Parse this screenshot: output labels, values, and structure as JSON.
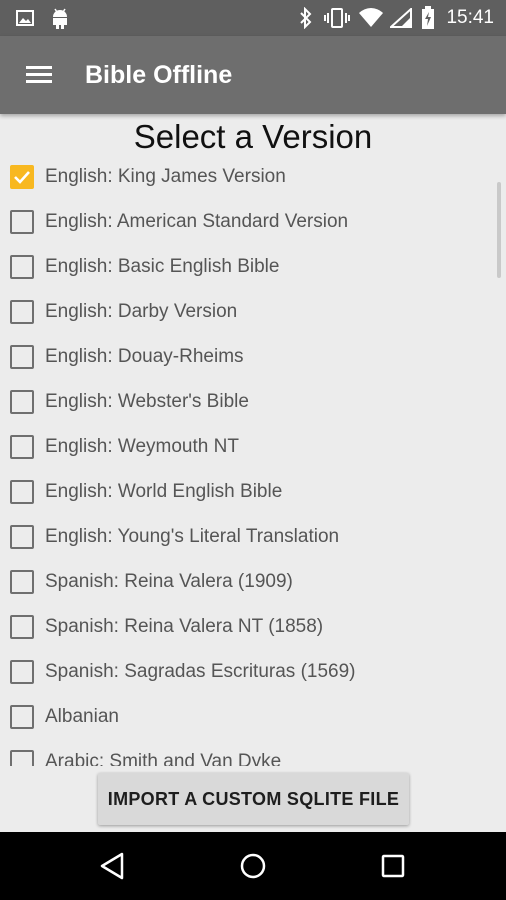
{
  "status_bar": {
    "time": "15:41",
    "icons": [
      "image-icon",
      "android-icon",
      "bluetooth-icon",
      "vibrate-icon",
      "wifi-icon",
      "signal-icon",
      "battery-charging-icon"
    ]
  },
  "app_bar": {
    "title": "Bible Offline",
    "menu_icon": "hamburger-menu-icon"
  },
  "main": {
    "heading": "Select a Version",
    "versions": [
      {
        "label": "English: King James Version",
        "checked": true
      },
      {
        "label": "English: American Standard Version",
        "checked": false
      },
      {
        "label": "English: Basic English Bible",
        "checked": false
      },
      {
        "label": "English: Darby Version",
        "checked": false
      },
      {
        "label": "English: Douay-Rheims",
        "checked": false
      },
      {
        "label": "English: Webster's Bible",
        "checked": false
      },
      {
        "label": "English: Weymouth NT",
        "checked": false
      },
      {
        "label": "English: World English Bible",
        "checked": false
      },
      {
        "label": "English: Young's Literal Translation",
        "checked": false
      },
      {
        "label": "Spanish: Reina Valera (1909)",
        "checked": false
      },
      {
        "label": "Spanish: Reina Valera NT (1858)",
        "checked": false
      },
      {
        "label": "Spanish: Sagradas Escrituras (1569)",
        "checked": false
      },
      {
        "label": "Albanian",
        "checked": false
      },
      {
        "label": "Arabic: Smith and Van Dyke",
        "checked": false
      }
    ],
    "import_button": "IMPORT A CUSTOM SQLITE FILE"
  },
  "nav_bar": {
    "icons": [
      "back-icon",
      "home-icon",
      "recents-icon"
    ]
  },
  "colors": {
    "accent": "#f8b820",
    "app_bar": "#6e6e6e",
    "status_bar": "#5f5f5f"
  }
}
